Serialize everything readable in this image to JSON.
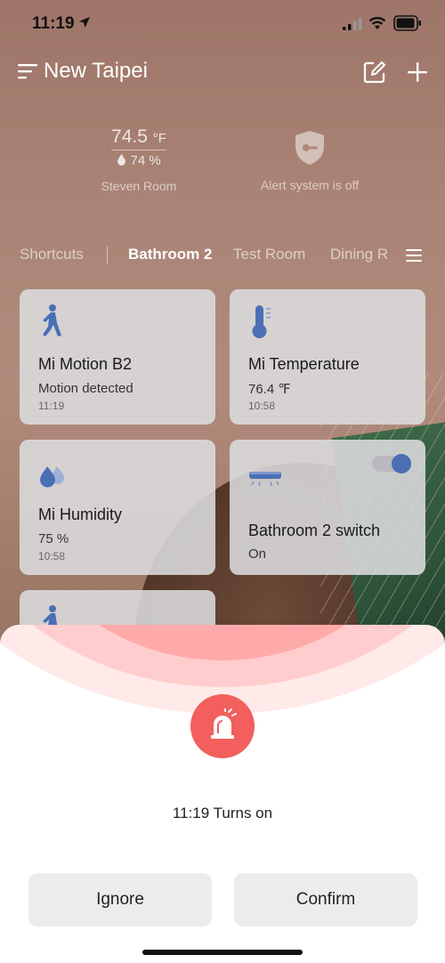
{
  "status_bar": {
    "time": "11:19"
  },
  "header": {
    "title": "New Taipei"
  },
  "summary": {
    "temperature": "74.5",
    "temperature_unit": "°F",
    "humidity": "74 %",
    "room_name": "Steven Room",
    "alert_status": "Alert system is off"
  },
  "tabs": [
    "Shortcuts",
    "Bathroom 2",
    "Test Room",
    "Dining R"
  ],
  "active_tab": "Bathroom 2",
  "cards": [
    {
      "name": "Mi Motion B2",
      "status": "Motion detected",
      "time": "11:19",
      "icon": "walking-person-icon"
    },
    {
      "name": "Mi Temperature",
      "status": "76.4 ℉",
      "time": "10:58",
      "icon": "thermometer-icon"
    },
    {
      "name": "Mi Humidity",
      "status": "75 %",
      "time": "10:58",
      "icon": "water-drops-icon"
    },
    {
      "name": "Bathroom 2 switch",
      "status": "On",
      "icon": "ceiling-light-icon",
      "toggle_on": true
    },
    {
      "icon": "walking-person-icon"
    }
  ],
  "sheet": {
    "message": "11:19 Turns on",
    "ignore_label": "Ignore",
    "confirm_label": "Confirm",
    "icon": "alarm-siren-icon"
  },
  "colors": {
    "accent_blue": "#4a6fb5",
    "alarm_red": "#f25f5c",
    "button_gray": "#ececec"
  }
}
